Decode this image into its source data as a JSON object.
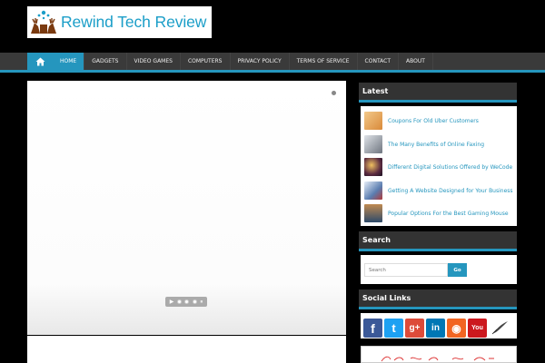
{
  "site": {
    "title": "Rewind Tech Review"
  },
  "nav": {
    "home_icon": "home-icon",
    "items": [
      "HOME",
      "GADGETS",
      "VIDEO GAMES",
      "COMPUTERS",
      "PRIVACY POLICY",
      "TERMS OF SERVICE",
      "CONTACT",
      "ABOUT"
    ],
    "active": "HOME"
  },
  "slider": {
    "controls": {
      "play": "▶",
      "pause": "⏸"
    }
  },
  "sidebar": {
    "latest": {
      "title": "Latest",
      "items": [
        {
          "label": "Coupons For Old Uber Customers",
          "thumb_color": "#e8a85c"
        },
        {
          "label": "The Many Benefits of Online Faxing",
          "thumb_color": "#9aa0a8"
        },
        {
          "label": "Different Digital Solutions Offered by WeCode",
          "thumb_color": "#3b2a3a"
        },
        {
          "label": "Getting A Website Designed for Your Business",
          "thumb_color": "#5a7db0"
        },
        {
          "label": "Popular Options For the Best Gaming Mouse",
          "thumb_color": "#2d4a6a"
        }
      ]
    },
    "search": {
      "title": "Search",
      "placeholder": "Search",
      "button": "Go"
    },
    "social": {
      "title": "Social Links",
      "links": [
        {
          "name": "facebook",
          "glyph": "f",
          "color": "#3b5998"
        },
        {
          "name": "twitter",
          "glyph": "t",
          "color": "#1da1f2"
        },
        {
          "name": "googleplus",
          "glyph": "g+",
          "color": "#dd4b39"
        },
        {
          "name": "linkedin",
          "glyph": "in",
          "color": "#0077b5"
        },
        {
          "name": "rss",
          "glyph": "◉",
          "color": "#f26522"
        },
        {
          "name": "youtube",
          "glyph": "You",
          "color": "#cc181e"
        }
      ]
    }
  },
  "colors": {
    "accent": "#2596be",
    "nav_bg": "#3a3a3a",
    "page_bg": "#000000"
  }
}
